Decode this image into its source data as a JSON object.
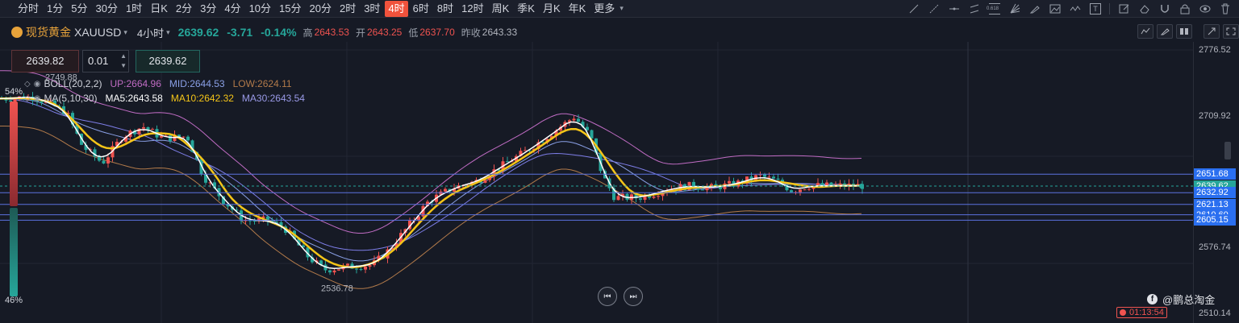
{
  "timeframes": [
    "分时",
    "1分",
    "5分",
    "30分",
    "1时",
    "日K",
    "2分",
    "3分",
    "4分",
    "10分",
    "15分",
    "20分",
    "2时",
    "3时",
    "4时",
    "6时",
    "8时",
    "12时",
    "周K",
    "季K",
    "月K",
    "年K",
    "更多"
  ],
  "active_timeframe_index": 14,
  "more_caret": "▾",
  "tools": [
    "trend-line-icon",
    "ray-icon",
    "horizontal-line-icon",
    "parallel-channel-icon",
    "fib-icon",
    "fan-icon",
    "pencil-icon",
    "image-icon",
    "wave-icon",
    "text-icon",
    "edit-icon",
    "eraser-icon",
    "magnet-icon",
    "lock-icon",
    "eye-icon",
    "trash-icon"
  ],
  "fib_label": "0.618",
  "text_tool_label": "T",
  "symbol": {
    "name_cn": "现货黄金",
    "code": "XAUUSD",
    "caret": "▾",
    "interval": "4小时"
  },
  "quote": {
    "price": "2639.62",
    "change": "-3.71",
    "change_pct": "-0.14%",
    "high_label": "高",
    "high": "2643.53",
    "open_label": "开",
    "open": "2643.25",
    "low_label": "低",
    "low": "2637.70",
    "prev_label": "昨收",
    "prev_close": "2643.33"
  },
  "order": {
    "sell_price": "2639.82",
    "quantity": "0.01",
    "buy_price": "2639.62",
    "stepper_up": "▲",
    "stepper_down": "▼"
  },
  "legend_boll": {
    "name": "BOLL(20,2,2)",
    "up": "UP:2664.96",
    "mid": "MID:2644.53",
    "low": "LOW:2624.11"
  },
  "legend_ma": {
    "name": "MA(5,10,30)",
    "ma5": "MA5:2643.58",
    "ma10": "MA10:2642.32",
    "ma30": "MA30:2643.54"
  },
  "legend_icons": {
    "collapse": "◇",
    "eye": "◉"
  },
  "sentiment": {
    "top_pct": "54%",
    "bottom_pct": "46%",
    "top_value": 0.54,
    "bottom_value": 0.46
  },
  "axis_ticks": [
    "2776.52",
    "2709.92",
    "2576.74",
    "2510.14"
  ],
  "price_levels": [
    {
      "price": "2651.68",
      "cur": false
    },
    {
      "price": "2639.62",
      "cur": true
    },
    {
      "price": "2632.92",
      "cur": false
    },
    {
      "price": "2621.13",
      "cur": false
    },
    {
      "price": "2610.60",
      "cur": false
    },
    {
      "price": "2605.15",
      "cur": false
    }
  ],
  "marks": {
    "high": "2749.88",
    "low": "2536.78"
  },
  "watermark": {
    "icon_letter": "f",
    "text": "@鹏总淘金"
  },
  "countdown": "01:13:54",
  "nav_buttons": {
    "prev": "⏮",
    "next": "⏭"
  },
  "colors": {
    "up": "#ef5350",
    "down": "#26a69a",
    "ma5": "#ffffff",
    "ma10": "#f5c518",
    "ma30": "#7e7ee8",
    "boll_up": "#c06cc4",
    "boll_mid": "#8aa0e6",
    "boll_low": "#b27a4a",
    "level_line": "#5b72e0",
    "accent": "#f0523c"
  }
}
